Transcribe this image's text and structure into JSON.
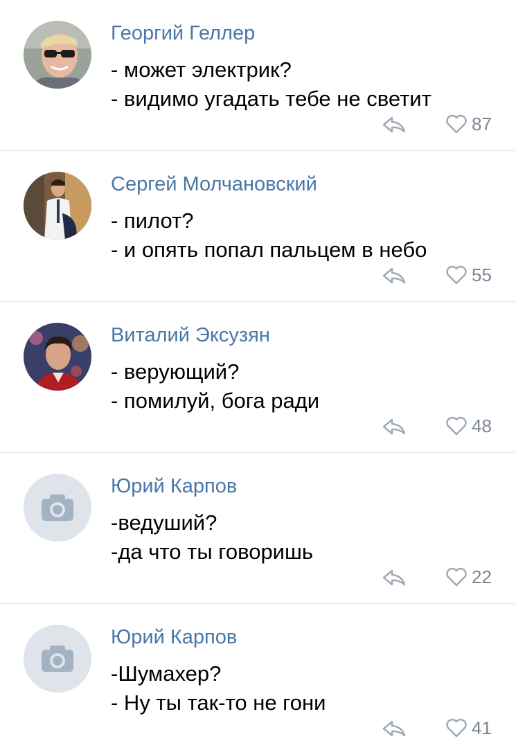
{
  "comments": [
    {
      "author": "Георгий Геллер",
      "lines": [
        "- может электрик?",
        "- видимо угадать тебе не светит"
      ],
      "likes": "87",
      "avatar": "photo"
    },
    {
      "author": "Сергей Молчановский",
      "lines": [
        "- пилот?",
        "- и опять попал пальцем в небо"
      ],
      "likes": "55",
      "avatar": "photo"
    },
    {
      "author": "Виталий Эксузян",
      "lines": [
        "- верующий?",
        "- помилуй, бога ради"
      ],
      "likes": "48",
      "avatar": "photo"
    },
    {
      "author": "Юрий Карпов",
      "lines": [
        "-ведуший?",
        "-да что ты говоришь"
      ],
      "likes": "22",
      "avatar": "camera-placeholder-icon"
    },
    {
      "author": "Юрий Карпов",
      "lines": [
        "-Шумахер?",
        "- Ну ты так-то не гони"
      ],
      "likes": "41",
      "avatar": "camera-placeholder-icon"
    }
  ],
  "colors": {
    "author": "#4a76a8",
    "text": "#000000",
    "meta": "#7a8593",
    "divider": "#e3e6ea"
  }
}
